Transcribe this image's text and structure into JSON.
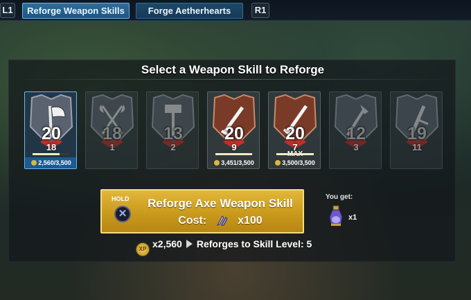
{
  "topbar": {
    "left_bumper": "L1",
    "right_bumper": "R1",
    "tabs": [
      {
        "label": "Reforge Weapon Skills",
        "active": true
      },
      {
        "label": "Forge Aetherhearts",
        "active": false
      }
    ]
  },
  "panel": {
    "title": "Select a Weapon Skill to Reforge"
  },
  "skills": [
    {
      "icon": "axe-icon",
      "level": "20",
      "sub": "18",
      "xp": "2,560/3,500",
      "progress": 0.73,
      "state": "selected",
      "tier": "silver"
    },
    {
      "icon": "crossed-axes-icon",
      "level": "18",
      "sub": "1",
      "xp": "",
      "progress": null,
      "state": "locked",
      "tier": "silver"
    },
    {
      "icon": "hammer-icon",
      "level": "13",
      "sub": "2",
      "xp": "",
      "progress": null,
      "state": "locked",
      "tier": "silver"
    },
    {
      "icon": "sword-icon",
      "level": "20",
      "sub": "9",
      "xp": "3,451/3,500",
      "progress": 0.986,
      "state": "normal",
      "tier": "bronze"
    },
    {
      "icon": "blade-icon",
      "level": "20",
      "sub": "7",
      "xp": "3,500/3,500",
      "progress": 1.0,
      "max_label": "MAX",
      "state": "normal",
      "tier": "bronze"
    },
    {
      "icon": "war-pike-icon",
      "level": "12",
      "sub": "3",
      "xp": "",
      "progress": null,
      "state": "locked",
      "tier": "silver"
    },
    {
      "icon": "chain-blades-icon",
      "level": "19",
      "sub": "11",
      "xp": "",
      "progress": null,
      "state": "locked",
      "tier": "silver"
    }
  ],
  "reforge_button": {
    "hold_label": "HOLD",
    "button_glyph": "✕",
    "label": "Reforge Axe Weapon Skill",
    "cost_label": "Cost:",
    "cost_value": "x100"
  },
  "reward": {
    "label": "You get:",
    "icon": "potion-icon",
    "count": "x1"
  },
  "conversion": {
    "xp_icon_text": "XP",
    "xp_amount": "x2,560",
    "text": "Reforges to Skill Level: 5"
  },
  "colors": {
    "accent_blue": "#6fb6ea",
    "button_gold": "#d4a82a",
    "bronze": "#8a4a32",
    "silver": "#6a7480"
  }
}
